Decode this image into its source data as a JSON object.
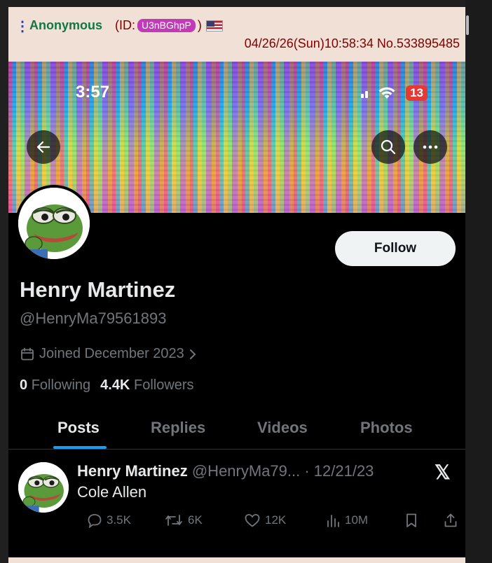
{
  "post": {
    "menu_glyph": "⋮",
    "name": "Anonymous",
    "id_prefix": "(ID: ",
    "id": "U3nBGhpP",
    "id_suffix": ")",
    "flag": "us-flag-icon",
    "date": "04/26/26(Sun)10:58:34 No.533895485"
  },
  "phone": {
    "time": "3:57",
    "battery": "13"
  },
  "profile": {
    "follow_label": "Follow",
    "display_name": "Henry Martinez",
    "handle": "@HenryMa79561893",
    "joined": "Joined December 2023",
    "following_count": "0",
    "following_label": "Following",
    "followers_count": "4.4K",
    "followers_label": "Followers"
  },
  "tabs": [
    {
      "label": "Posts",
      "active": true
    },
    {
      "label": "Replies",
      "active": false
    },
    {
      "label": "Videos",
      "active": false
    },
    {
      "label": "Photos",
      "active": false
    }
  ],
  "tweet": {
    "name": "Henry Martinez",
    "meta": "@HenryMa79... · 12/21/23",
    "text": "Cole Allen",
    "replies": "3.5K",
    "reposts": "6K",
    "likes": "12K",
    "views": "10M",
    "x_logo": "𝕏"
  },
  "colors": {
    "post_bg": "#f0e0d6",
    "name_green": "#117743",
    "maroon": "#800000",
    "id_badge": "#c23ab8",
    "accent_blue": "#1d9bf0",
    "text_primary": "#e7e9ea",
    "text_secondary": "#71767b"
  }
}
